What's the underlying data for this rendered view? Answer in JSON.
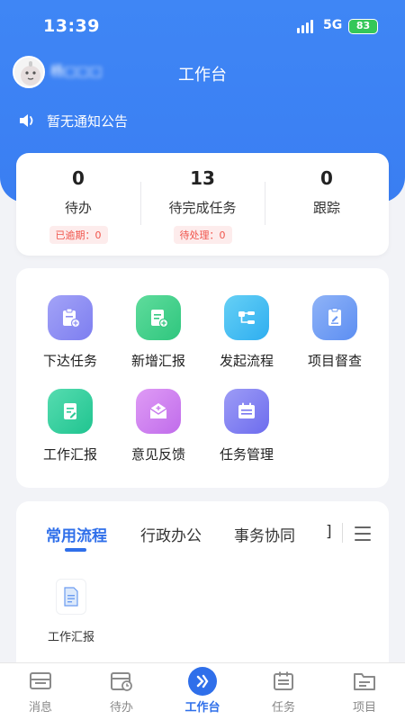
{
  "status_bar": {
    "time": "13:39",
    "network": "5G",
    "battery": "83"
  },
  "header": {
    "user_name": "杨□□□",
    "title": "工作台"
  },
  "notice": {
    "text": "暂无通知公告"
  },
  "stats": [
    {
      "value": "0",
      "label": "待办",
      "chip": "已逾期：0"
    },
    {
      "value": "13",
      "label": "待完成任务",
      "chip": "待处理：0"
    },
    {
      "value": "0",
      "label": "跟踪",
      "chip": ""
    }
  ],
  "apps": [
    {
      "label": "下达任务",
      "icon": "assign-task-icon",
      "color": "#8f8ff4"
    },
    {
      "label": "新增汇报",
      "icon": "new-report-icon",
      "color": "#3fd08a"
    },
    {
      "label": "发起流程",
      "icon": "start-process-icon",
      "color": "#43bff0"
    },
    {
      "label": "项目督查",
      "icon": "project-supervise-icon",
      "color": "#6c9bf5"
    },
    {
      "label": "工作汇报",
      "icon": "work-report-icon",
      "color": "#36d2a0"
    },
    {
      "label": "意见反馈",
      "icon": "feedback-icon",
      "color": "#d27ef0"
    },
    {
      "label": "任务管理",
      "icon": "task-manage-icon",
      "color": "#7f7ef2"
    }
  ],
  "flow_tabs": [
    {
      "label": "常用流程",
      "active": true
    },
    {
      "label": "行政办公",
      "active": false
    },
    {
      "label": "事务协同",
      "active": false
    },
    {
      "label": "]",
      "active": false
    }
  ],
  "flow_items": [
    {
      "label": "工作汇报",
      "icon": "document-icon"
    }
  ],
  "tabbar": [
    {
      "label": "消息",
      "icon": "message-icon",
      "active": false
    },
    {
      "label": "待办",
      "icon": "todo-icon",
      "active": false
    },
    {
      "label": "工作台",
      "icon": "workbench-icon",
      "active": true
    },
    {
      "label": "任务",
      "icon": "task-icon",
      "active": false
    },
    {
      "label": "项目",
      "icon": "project-folder-icon",
      "active": false
    }
  ],
  "colors": {
    "primary": "#2f6fea",
    "header_bg": "#3f86f5",
    "chip_red": "#f0544b"
  }
}
